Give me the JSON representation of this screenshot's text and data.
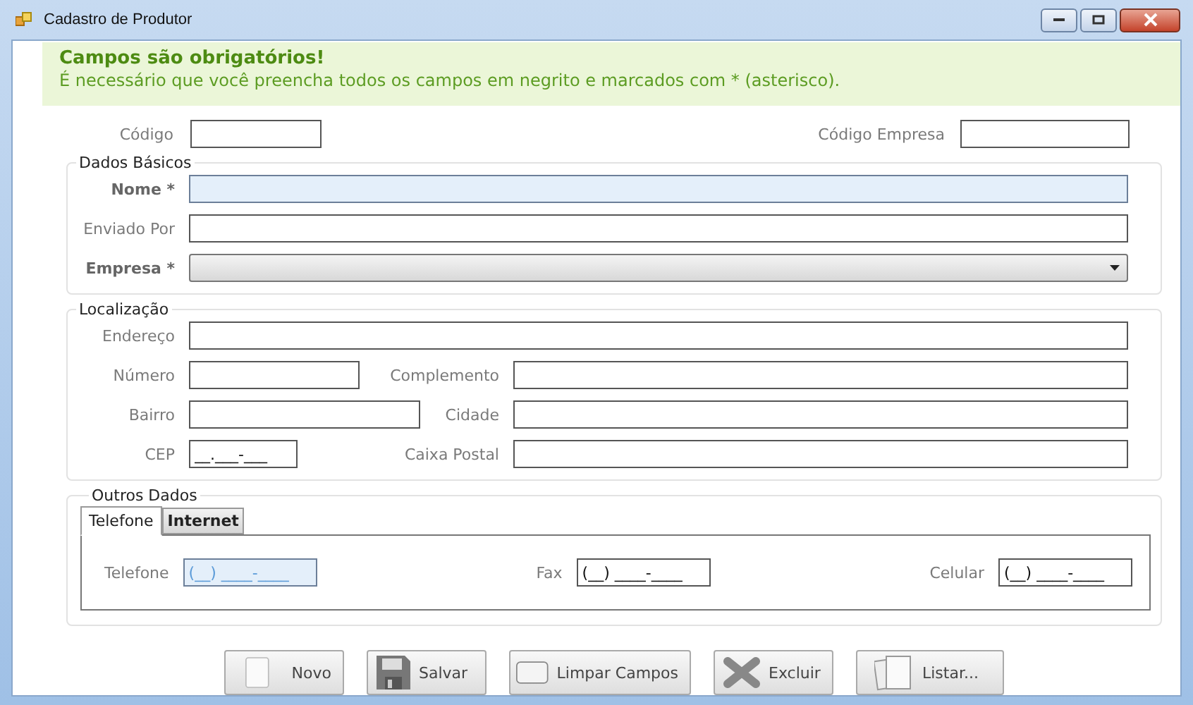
{
  "window": {
    "title": "Cadastro de Produtor"
  },
  "notice": {
    "title": "Campos são obrigatórios!",
    "message": "É necessário que você preencha todos os campos em negrito e marcados com * (asterisco)."
  },
  "header_fields": [
    {
      "label": "Código"
    },
    {
      "label": "Código Empresa"
    }
  ],
  "groups": [
    {
      "title": "Dados Básicos",
      "rows": [
        [
          {
            "label": "Nome *",
            "kind": "text",
            "required": true,
            "highlighted": true
          }
        ],
        [
          {
            "label": "Enviado Por",
            "kind": "text",
            "required": false,
            "highlighted": false
          }
        ],
        [
          {
            "label": "Empresa *",
            "kind": "dropdown",
            "required": true,
            "highlighted": false
          }
        ]
      ]
    },
    {
      "title": "Localização",
      "rows": [
        [
          {
            "label": "Endereço",
            "kind": "text",
            "required": false,
            "highlighted": false
          }
        ],
        [
          {
            "label": "Número",
            "kind": "text",
            "required": false,
            "highlighted": false
          },
          {
            "label": "Complemento",
            "kind": "text",
            "required": false,
            "highlighted": false
          }
        ],
        [
          {
            "label": "Bairro",
            "kind": "text",
            "required": false,
            "highlighted": false
          },
          {
            "label": "Cidade",
            "kind": "text",
            "required": false,
            "highlighted": false
          }
        ],
        [
          {
            "label": "CEP",
            "kind": "text",
            "value": "__.___-___",
            "required": false,
            "highlighted": false
          },
          {
            "label": "Caixa Postal",
            "kind": "text",
            "required": false,
            "highlighted": false
          }
        ]
      ]
    }
  ],
  "other": {
    "title": "Outros Dados",
    "tabs": [
      {
        "label": "Telefone",
        "selected": true
      },
      {
        "label": "Internet",
        "selected": false
      }
    ],
    "fields": [
      {
        "label": "Telefone",
        "value": "(__) ____-____",
        "highlighted": true
      },
      {
        "label": "Fax",
        "value": "(__) ____-____",
        "highlighted": false
      },
      {
        "label": "Celular",
        "value": "(__) ____-____",
        "highlighted": false
      }
    ]
  },
  "buttons": [
    {
      "label": "Novo"
    },
    {
      "label": "Salvar"
    },
    {
      "label": "Limpar Campos"
    },
    {
      "label": "Excluir"
    },
    {
      "label": "Listar..."
    }
  ]
}
